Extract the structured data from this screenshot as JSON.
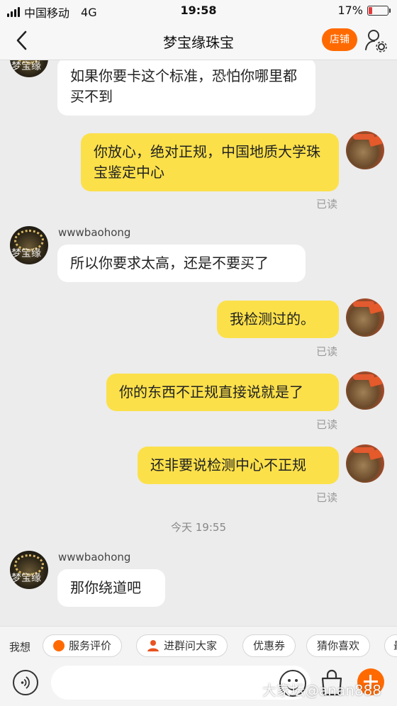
{
  "status_bar": {
    "carrier": "中国移动",
    "network": "4G",
    "time": "19:58",
    "battery_percent_text": "17%",
    "battery_level": 0.17
  },
  "nav": {
    "title": "梦宝缘珠宝",
    "shop_button": "店铺"
  },
  "avatar_watermark": "梦宝缘",
  "messages": [
    {
      "side": "in",
      "text": "如果你要卡这个标准，恐怕你哪里都买不到"
    },
    {
      "side": "out",
      "text": "你放心，绝对正规，中国地质大学珠宝鉴定中心",
      "status": "已读"
    },
    {
      "side": "in",
      "sender": "wwwbaohong",
      "text": "所以你要求太高，还是不要买了"
    },
    {
      "side": "out",
      "text": "我检测过的。",
      "status": "已读"
    },
    {
      "side": "out",
      "text": "你的东西不正规直接说就是了",
      "status": "已读"
    },
    {
      "side": "out",
      "text": "还非要说检测中心不正规",
      "status": "已读"
    },
    {
      "type": "time",
      "text": "今天 19:55"
    },
    {
      "side": "in",
      "sender": "wwwbaohong",
      "text": "那你绕道吧"
    }
  ],
  "quick_bar": {
    "label": "我想",
    "chips": [
      "服务评价",
      "进群问大家",
      "优惠券",
      "猜你喜欢",
      "最"
    ]
  },
  "input_bar": {
    "value": "",
    "placeholder": ""
  },
  "watermark": "大家坛@anan888",
  "colors": {
    "accent": "#ff6a00",
    "out_bubble": "#fbe04a",
    "in_bubble": "#ffffff",
    "background": "#ececec"
  }
}
